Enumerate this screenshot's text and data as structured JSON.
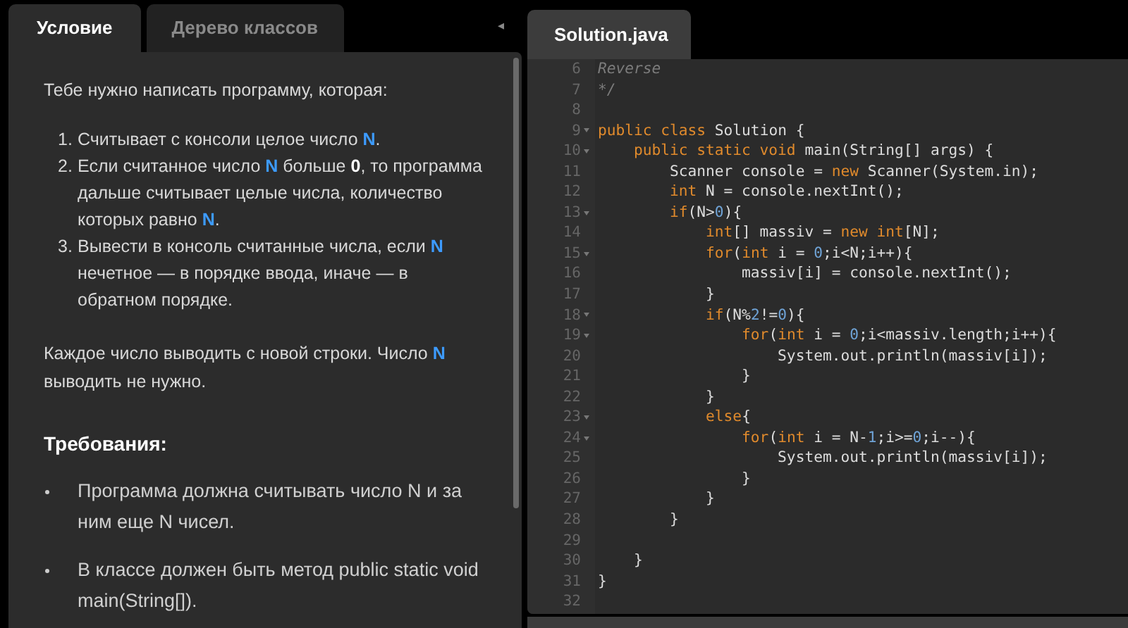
{
  "left_tabs": [
    {
      "label": "Условие",
      "selected": true
    },
    {
      "label": "Дерево классов",
      "selected": false
    }
  ],
  "collapse_button": "◂",
  "task": {
    "intro": "Тебе нужно написать программу, которая:",
    "steps": [
      {
        "number": "1.",
        "segments": [
          {
            "text": "Считывает с консоли целое число ",
            "kind": "plain"
          },
          {
            "text": "N",
            "kind": "var"
          },
          {
            "text": ".",
            "kind": "plain"
          }
        ]
      },
      {
        "number": "2.",
        "segments": [
          {
            "text": "Если считанное число ",
            "kind": "plain"
          },
          {
            "text": "N",
            "kind": "var"
          },
          {
            "text": " больше ",
            "kind": "plain"
          },
          {
            "text": "0",
            "kind": "bold"
          },
          {
            "text": ", то программа дальше считывает целые числа, количество которых равно ",
            "kind": "plain"
          },
          {
            "text": "N",
            "kind": "var"
          },
          {
            "text": ".",
            "kind": "plain"
          }
        ]
      },
      {
        "number": "3.",
        "segments": [
          {
            "text": "Вывести в консоль считанные числа, если ",
            "kind": "plain"
          },
          {
            "text": "N",
            "kind": "var"
          },
          {
            "text": " нечетное — в порядке ввода, иначе — в обратном порядке.",
            "kind": "plain"
          }
        ]
      }
    ],
    "note": [
      {
        "text": "Каждое число выводить с новой строки. Число ",
        "kind": "plain"
      },
      {
        "text": "N",
        "kind": "var"
      },
      {
        "text": " выводить не нужно.",
        "kind": "plain"
      }
    ],
    "requirements_title": "Требования:",
    "requirements": [
      "Программа должна считывать число N и за ним еще N чисел.",
      "В классе должен быть метод public static void main(String[])."
    ]
  },
  "editor": {
    "tab": {
      "label": "Solution.java",
      "selected": true
    },
    "lines": [
      {
        "number": "6",
        "foldable": false,
        "tokens": [
          {
            "text": "Reverse",
            "kind": "comment"
          }
        ]
      },
      {
        "number": "7",
        "foldable": false,
        "tokens": [
          {
            "text": "*/",
            "kind": "comment"
          }
        ]
      },
      {
        "number": "8",
        "foldable": false
      },
      {
        "number": "9",
        "foldable": true,
        "tokens": [
          {
            "text": "public class",
            "kind": "keyword"
          },
          {
            "text": " Solution {",
            "kind": "plain"
          }
        ]
      },
      {
        "number": "10",
        "foldable": true,
        "tokens": [
          {
            "text": "    public static void",
            "kind": "keyword"
          },
          {
            "text": " main(String[] args) {",
            "kind": "plain"
          }
        ]
      },
      {
        "number": "11",
        "foldable": false,
        "tokens": [
          {
            "text": "        Scanner console = ",
            "kind": "plain"
          },
          {
            "text": "new",
            "kind": "keyword"
          },
          {
            "text": " Scanner(System.in);",
            "kind": "plain"
          }
        ]
      },
      {
        "number": "12",
        "foldable": false,
        "tokens": [
          {
            "text": "        int",
            "kind": "keyword"
          },
          {
            "text": " N = console.nextInt();",
            "kind": "plain"
          }
        ]
      },
      {
        "number": "13",
        "foldable": true,
        "tokens": [
          {
            "text": "        if",
            "kind": "keyword"
          },
          {
            "text": "(N>",
            "kind": "plain"
          },
          {
            "text": "0",
            "kind": "number"
          },
          {
            "text": "){",
            "kind": "plain"
          }
        ]
      },
      {
        "number": "14",
        "foldable": false,
        "tokens": [
          {
            "text": "            int",
            "kind": "keyword"
          },
          {
            "text": "[] massiv = ",
            "kind": "plain"
          },
          {
            "text": "new int",
            "kind": "keyword"
          },
          {
            "text": "[N];",
            "kind": "plain"
          }
        ]
      },
      {
        "number": "15",
        "foldable": true,
        "tokens": [
          {
            "text": "            for",
            "kind": "keyword"
          },
          {
            "text": "(",
            "kind": "plain"
          },
          {
            "text": "int",
            "kind": "keyword"
          },
          {
            "text": " i = ",
            "kind": "plain"
          },
          {
            "text": "0",
            "kind": "number"
          },
          {
            "text": ";i<N;i++){",
            "kind": "plain"
          }
        ]
      },
      {
        "number": "16",
        "foldable": false,
        "tokens": [
          {
            "text": "                massiv[i] = console.nextInt();",
            "kind": "plain"
          }
        ]
      },
      {
        "number": "17",
        "foldable": false,
        "tokens": [
          {
            "text": "            }",
            "kind": "plain"
          }
        ]
      },
      {
        "number": "18",
        "foldable": true,
        "tokens": [
          {
            "text": "            if",
            "kind": "keyword"
          },
          {
            "text": "(N%",
            "kind": "plain"
          },
          {
            "text": "2",
            "kind": "number"
          },
          {
            "text": "!=",
            "kind": "plain"
          },
          {
            "text": "0",
            "kind": "number"
          },
          {
            "text": "){",
            "kind": "plain"
          }
        ]
      },
      {
        "number": "19",
        "foldable": true,
        "tokens": [
          {
            "text": "                for",
            "kind": "keyword"
          },
          {
            "text": "(",
            "kind": "plain"
          },
          {
            "text": "int",
            "kind": "keyword"
          },
          {
            "text": " i = ",
            "kind": "plain"
          },
          {
            "text": "0",
            "kind": "number"
          },
          {
            "text": ";i<massiv.length;i++){",
            "kind": "plain"
          }
        ]
      },
      {
        "number": "20",
        "foldable": false,
        "tokens": [
          {
            "text": "                    System.out.println(massiv[i]);",
            "kind": "plain"
          }
        ]
      },
      {
        "number": "21",
        "foldable": false,
        "tokens": [
          {
            "text": "                }",
            "kind": "plain"
          }
        ]
      },
      {
        "number": "22",
        "foldable": false,
        "tokens": [
          {
            "text": "            }",
            "kind": "plain"
          }
        ]
      },
      {
        "number": "23",
        "foldable": true,
        "tokens": [
          {
            "text": "            else",
            "kind": "keyword"
          },
          {
            "text": "{",
            "kind": "plain"
          }
        ]
      },
      {
        "number": "24",
        "foldable": true,
        "tokens": [
          {
            "text": "                for",
            "kind": "keyword"
          },
          {
            "text": "(",
            "kind": "plain"
          },
          {
            "text": "int",
            "kind": "keyword"
          },
          {
            "text": " i = N-",
            "kind": "plain"
          },
          {
            "text": "1",
            "kind": "number"
          },
          {
            "text": ";i>=",
            "kind": "plain"
          },
          {
            "text": "0",
            "kind": "number"
          },
          {
            "text": ";i--){",
            "kind": "plain"
          }
        ]
      },
      {
        "number": "25",
        "foldable": false,
        "tokens": [
          {
            "text": "                    System.out.println(massiv[i]);",
            "kind": "plain"
          }
        ]
      },
      {
        "number": "26",
        "foldable": false,
        "tokens": [
          {
            "text": "                }",
            "kind": "plain"
          }
        ]
      },
      {
        "number": "27",
        "foldable": false,
        "tokens": [
          {
            "text": "            }",
            "kind": "plain"
          }
        ]
      },
      {
        "number": "28",
        "foldable": false,
        "tokens": [
          {
            "text": "        }",
            "kind": "plain"
          }
        ]
      },
      {
        "number": "29",
        "foldable": false
      },
      {
        "number": "30",
        "foldable": false,
        "tokens": [
          {
            "text": "    }",
            "kind": "plain"
          }
        ]
      },
      {
        "number": "31",
        "foldable": false,
        "tokens": [
          {
            "text": "}",
            "kind": "plain"
          }
        ]
      },
      {
        "number": "32",
        "foldable": false
      }
    ]
  }
}
